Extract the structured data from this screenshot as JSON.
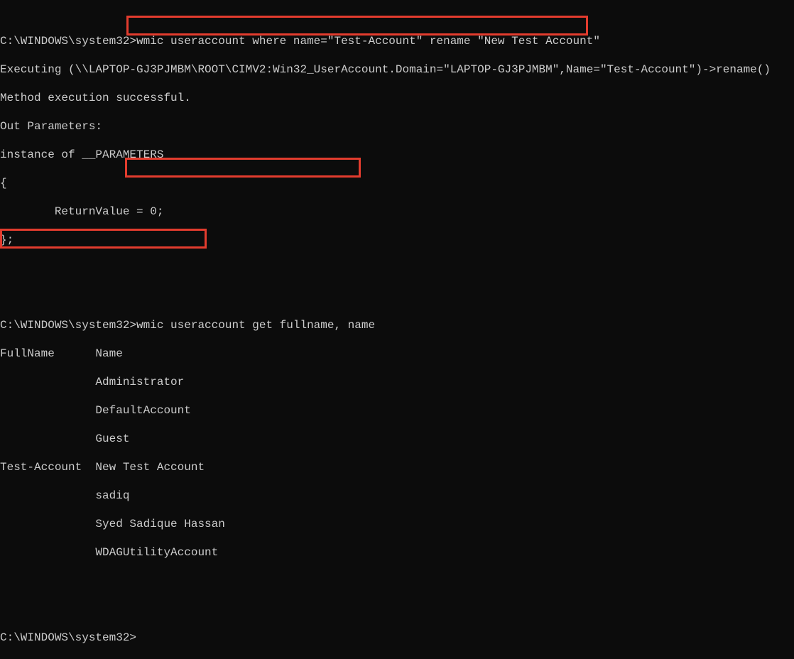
{
  "prompts": {
    "p1": "C:\\WINDOWS\\system32>",
    "p2": "C:\\WINDOWS\\system32>",
    "p3": "C:\\WINDOWS\\system32>"
  },
  "commands": {
    "cmd1": "wmic useraccount where name=\"Test-Account\" rename \"New Test Account\"",
    "cmd2": "wmic useraccount get fullname, name"
  },
  "output1": {
    "l1": "Executing (\\\\LAPTOP-GJ3PJMBM\\ROOT\\CIMV2:Win32_UserAccount.Domain=\"LAPTOP-GJ3PJMBM\",Name=\"Test-Account\")->rename()",
    "l2": "Method execution successful.",
    "l3": "Out Parameters:",
    "l4": "instance of __PARAMETERS",
    "l5": "{",
    "l6": "        ReturnValue = 0;",
    "l7": "};"
  },
  "table": {
    "header": "FullName      Name",
    "r1": "              Administrator",
    "r2": "              DefaultAccount",
    "r3": "              Guest",
    "r4": "Test-Account  New Test Account",
    "r5": "              sadiq",
    "r6": "              Syed Sadique Hassan",
    "r7": "              WDAGUtilityAccount"
  },
  "blank": ""
}
